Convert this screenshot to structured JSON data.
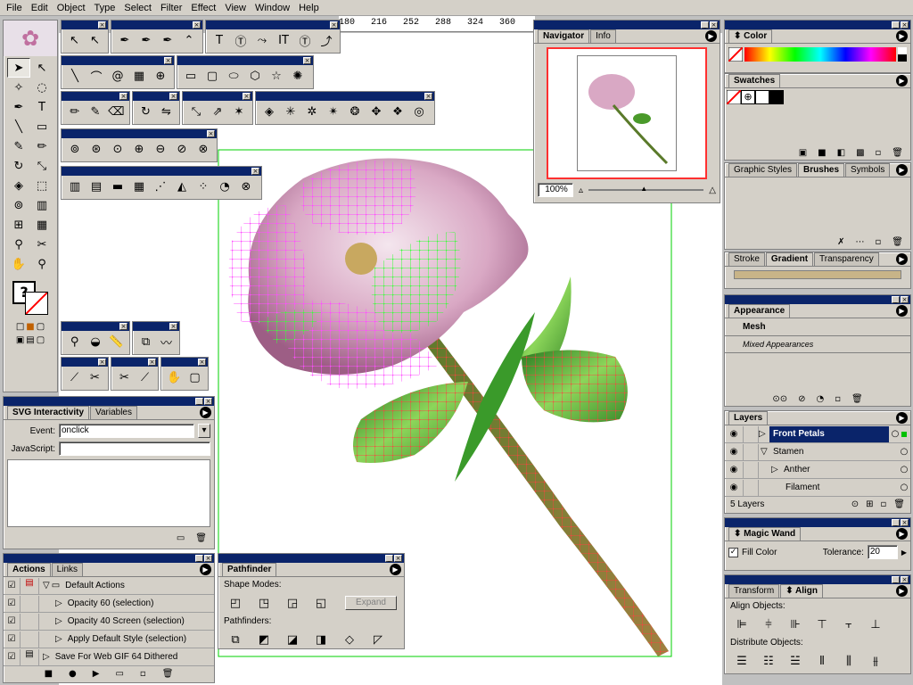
{
  "menus": [
    "File",
    "Edit",
    "Object",
    "Type",
    "Select",
    "Filter",
    "Effect",
    "View",
    "Window",
    "Help"
  ],
  "ruler": {
    "ticks": [
      "180",
      "216",
      "252",
      "288",
      "324",
      "360"
    ]
  },
  "navigator": {
    "tabs": [
      "Navigator",
      "Info"
    ],
    "zoom": "100%"
  },
  "color_panel": {
    "tab": "Color"
  },
  "swatches_panel": {
    "tab": "Swatches"
  },
  "brushes_panel": {
    "tabs": [
      "Graphic Styles",
      "Brushes",
      "Symbols"
    ]
  },
  "gradient_panel": {
    "tabs": [
      "Stroke",
      "Gradient",
      "Transparency"
    ]
  },
  "appearance_panel": {
    "tab": "Appearance",
    "item": "Mesh",
    "note": "Mixed Appearances"
  },
  "layers_panel": {
    "tab": "Layers",
    "rows": [
      {
        "name": "Front Petals"
      },
      {
        "name": "Stamen"
      },
      {
        "name": "Anther"
      },
      {
        "name": "Filament"
      }
    ],
    "count": "5 Layers"
  },
  "magic_wand": {
    "tab": "Magic Wand",
    "fill_color": "Fill Color",
    "tolerance_label": "Tolerance:",
    "tolerance_value": "20"
  },
  "align_panel": {
    "tabs": [
      "Transform",
      "Align"
    ],
    "align_label": "Align Objects:",
    "distribute_label": "Distribute Objects:"
  },
  "svg_panel": {
    "tabs": [
      "SVG Interactivity",
      "Variables"
    ],
    "event_label": "Event:",
    "event_value": "onclick",
    "js_label": "JavaScript:"
  },
  "pathfinder": {
    "tab": "Pathfinder",
    "shape_modes": "Shape Modes:",
    "expand": "Expand",
    "pathfinders": "Pathfinders:"
  },
  "actions_panel": {
    "tabs": [
      "Actions",
      "Links"
    ],
    "rows": [
      {
        "name": "Default Actions"
      },
      {
        "name": "Opacity 60 (selection)"
      },
      {
        "name": "Opacity 40 Screen (selection)"
      },
      {
        "name": "Apply Default Style (selection)"
      },
      {
        "name": "Save For Web GIF 64 Dithered"
      }
    ]
  },
  "colors": {
    "titlebar": "#0a246a",
    "mesh_pink": "#ff4dff",
    "mesh_green": "#39ff39",
    "mesh_red": "#ff4040",
    "selection": "#00d000"
  }
}
